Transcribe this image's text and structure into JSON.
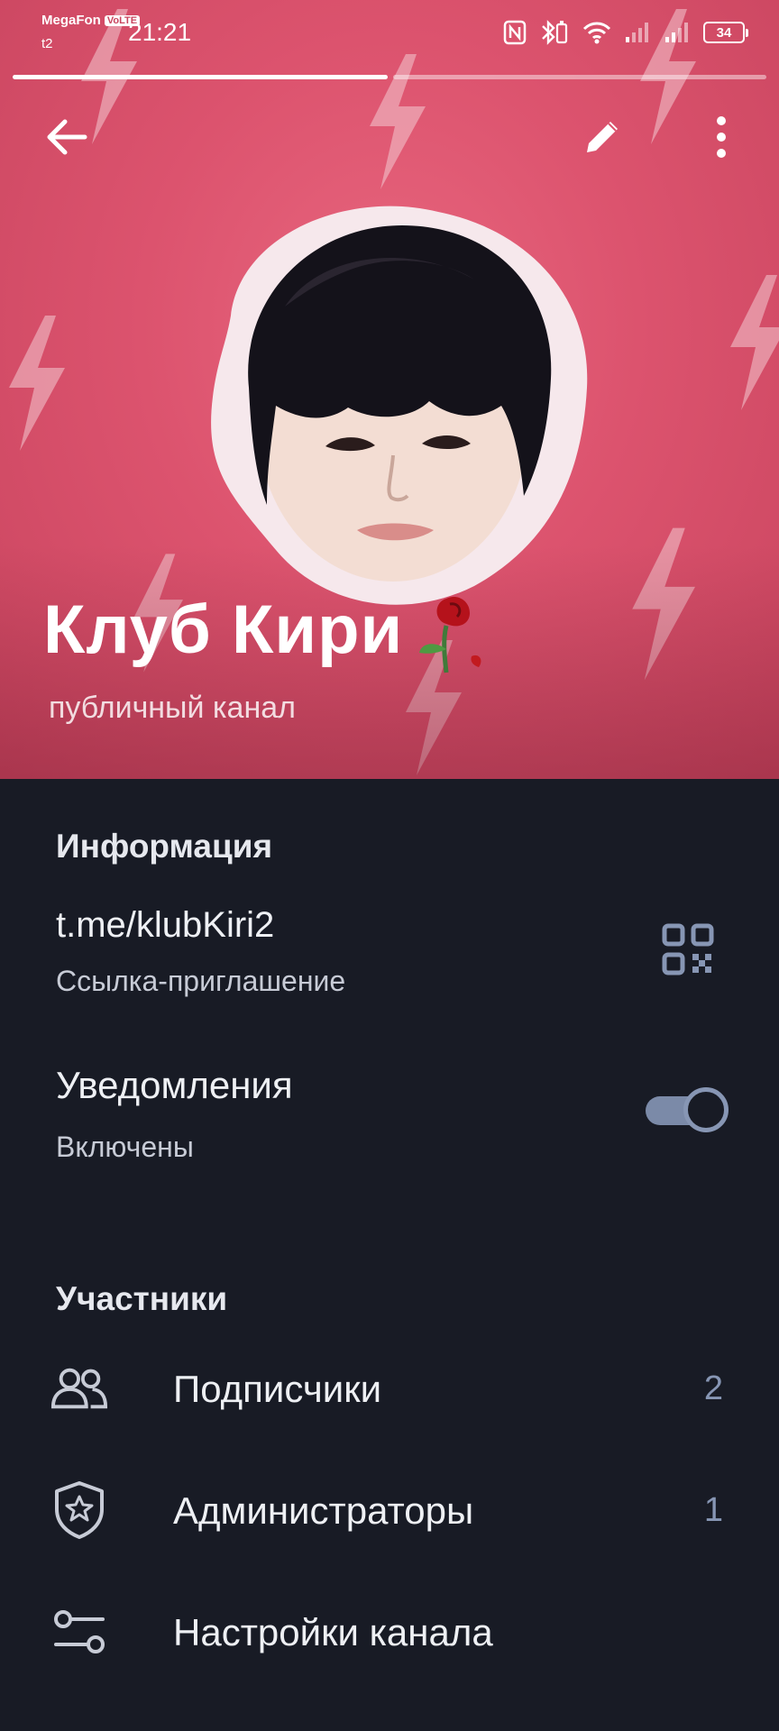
{
  "status_bar": {
    "carrier": "MegaFon",
    "volte": "VoLTE",
    "carrier2": "t2",
    "time": "21:21",
    "battery": "34"
  },
  "header": {
    "title": "Клуб Кири",
    "subtitle": "публичный канал",
    "background_color": "#dc536e",
    "back_icon": "arrow-left-icon",
    "edit_icon": "pencil-icon",
    "menu_icon": "more-vertical-icon",
    "story_progress": 0.5
  },
  "info": {
    "section_title": "Информация",
    "link": "t.me/klubKiri2",
    "link_caption": "Ссылка-приглашение",
    "qr_icon": "qr-code-icon",
    "notifications_label": "Уведомления",
    "notifications_state": "Включены",
    "notifications_enabled": true
  },
  "members": {
    "section_title": "Участники",
    "items": [
      {
        "label": "Подписчики",
        "count": "2",
        "icon": "users-icon"
      },
      {
        "label": "Администраторы",
        "count": "1",
        "icon": "shield-star-icon"
      },
      {
        "label": "Настройки канала",
        "count": "",
        "icon": "settings-sliders-icon"
      }
    ]
  },
  "colors": {
    "background": "#181b25",
    "accent": "#7b8aa8",
    "header": "#dc536e"
  }
}
